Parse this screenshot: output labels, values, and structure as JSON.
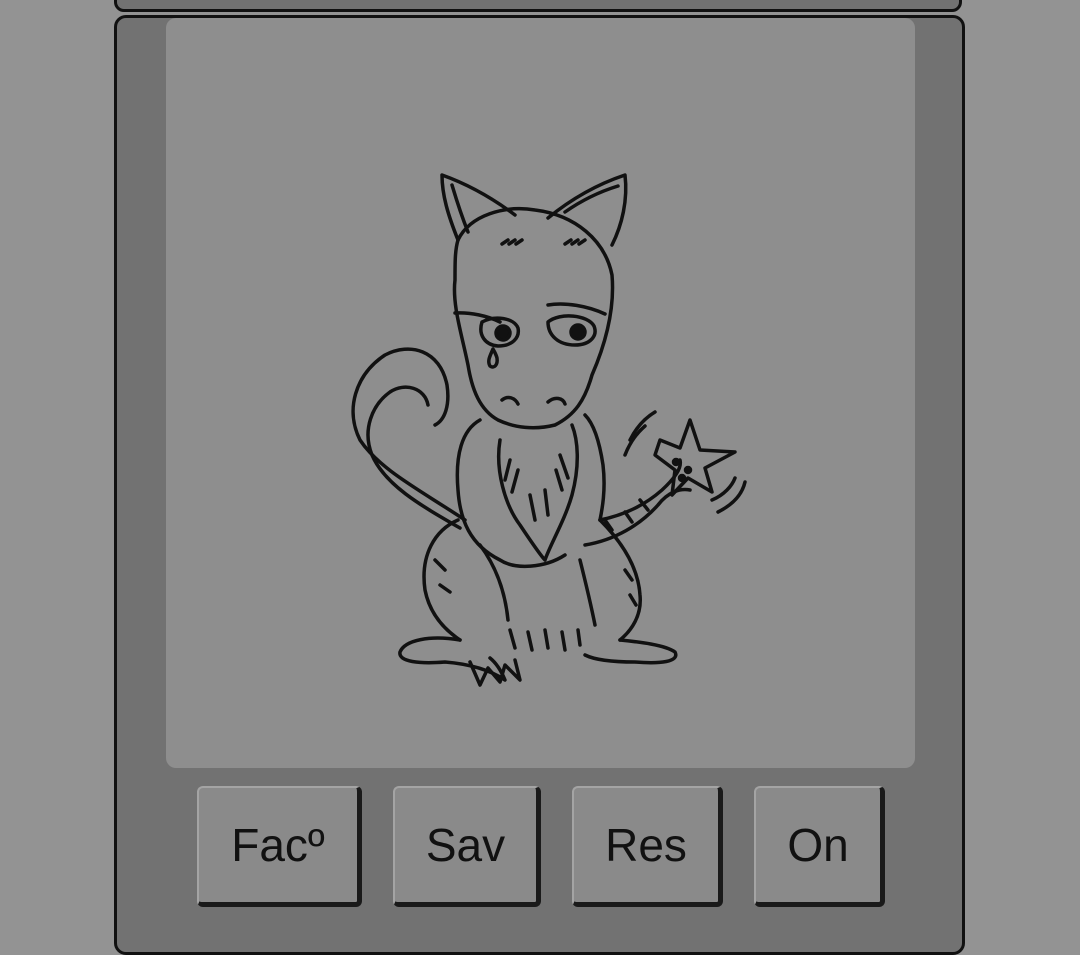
{
  "canvas": {
    "drawing": "cat-drawing-icon"
  },
  "buttons": [
    {
      "label": "Facº"
    },
    {
      "label": "Sav"
    },
    {
      "label": "Res"
    },
    {
      "label": "On"
    }
  ]
}
